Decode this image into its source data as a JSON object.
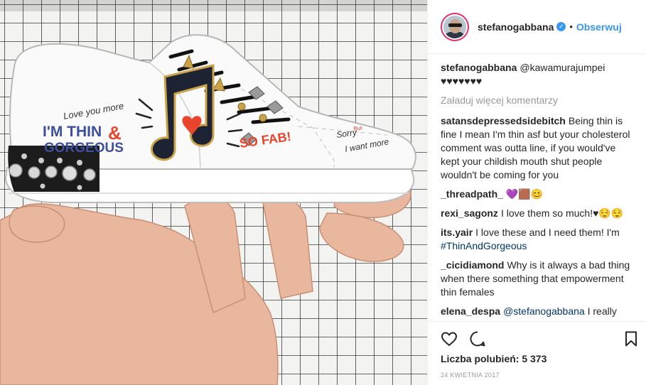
{
  "post": {
    "username": "stefanogabbana",
    "verified_icon": "verified-badge-icon",
    "separator": "•",
    "follow_label": "Obserwuj"
  },
  "caption": {
    "username": "stefanogabbana",
    "text": "@kawamurajumpei ♥♥♥♥♥♥♥"
  },
  "load_more_label": "Załaduj więcej komentarzy",
  "comments": [
    {
      "username": "satansdepressedsidebitch",
      "text": "Being thin is fine I mean I'm thin asf but your cholesterol comment was outta line, if you would've kept your childish mouth shut people wouldn't be coming for you"
    },
    {
      "username": "_threadpath_",
      "text": "💜🟫😊"
    },
    {
      "username": "rexi_sagonz",
      "text": "I love them so much!♥😌😌"
    },
    {
      "username": "its.yair",
      "text": "I love these and I need them! I'm",
      "hashtag": "#ThinAndGorgeous"
    },
    {
      "username": "_cicidiamond",
      "text": "Why is it always a bad thing when there something that empowerment thin females"
    },
    {
      "username": "elena_despa",
      "mention": "@stefanogabbana",
      "text": "I really hope that you realize your impact in teens world and eating and health disorders that"
    }
  ],
  "likes": {
    "label": "Liczba polubień: 5 373"
  },
  "date": "24 KWIETNIA 2017",
  "photo": {
    "shoe_text": {
      "love": "Love you more",
      "thin1": "I'M THIN",
      "amp": "&",
      "thin2": "GORGEOUS",
      "fab": "SO FAB!",
      "sorry": "Sorry",
      "but": "But",
      "want": "I want more"
    }
  },
  "icons": {
    "like": "heart-icon",
    "comment": "comment-icon",
    "save": "bookmark-icon"
  },
  "colors": {
    "accent": "#3897f0",
    "grid_line": "#3a3a3a",
    "grid_bg": "#f3f3f1",
    "red": "#e8452c",
    "blue_text": "#3d4f9f"
  }
}
